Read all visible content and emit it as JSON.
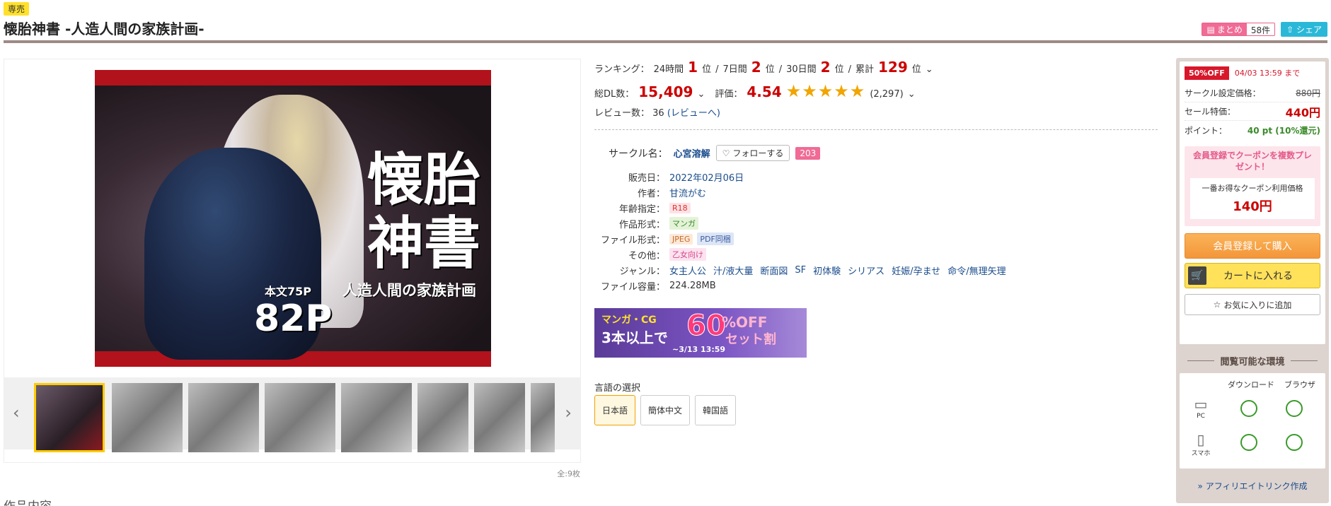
{
  "header": {
    "exclusive_badge": "専売",
    "title": "懐胎神書 -人造人間の家族計画-",
    "matome_label": "まとめ",
    "matome_count": "58件",
    "share_label": "シェア"
  },
  "gallery": {
    "cover_title_line1": "懐胎",
    "cover_title_line2": "神書",
    "cover_subtitle": "人造人間の家族計画",
    "cover_pages_small": "本文75P",
    "cover_pages": "82P",
    "total_images": "全:9枚"
  },
  "ranking": {
    "label": "ランキング：",
    "day_label": "24時間",
    "day_rank": "1",
    "week_label": "7日間",
    "week_rank": "2",
    "month_label": "30日間",
    "month_rank": "2",
    "total_label": "累計",
    "total_rank": "129",
    "unit": "位",
    "sep": "/"
  },
  "stats": {
    "dl_label": "総DL数：",
    "dl_count": "15,409",
    "rating_label": "評価：",
    "rating": "4.54",
    "stars": "★★★★★",
    "rating_count": "(2,297)",
    "review_label": "レビュー数：",
    "review_count": "36",
    "review_link": "(レビューへ)"
  },
  "circle": {
    "label": "サークル名：",
    "name": "心宮溶解",
    "follow_label": "フォローする",
    "follow_count": "203"
  },
  "specs": {
    "release_label": "販売日：",
    "release_date": "2022年02月06日",
    "author_label": "作者：",
    "author": "甘流がむ",
    "age_label": "年齢指定：",
    "age": "R18",
    "format_label": "作品形式：",
    "format": "マンガ",
    "file_label": "ファイル形式：",
    "file_type1": "JPEG",
    "file_type2": "PDF同梱",
    "other_label": "その他：",
    "other": "乙女向け",
    "genre_label": "ジャンル：",
    "genres": [
      "女主人公",
      "汁/液大量",
      "断面図",
      "SF",
      "初体験",
      "シリアス",
      "妊娠/孕ませ",
      "命令/無理矢理"
    ],
    "size_label": "ファイル容量：",
    "size": "224.28MB"
  },
  "banner": {
    "line1": "マンガ・CG",
    "line2": "3本以上で",
    "percent": "60",
    "off": "%OFF",
    "set": "セット割",
    "date": "~3/13 13:59"
  },
  "language": {
    "label": "言語の選択",
    "options": [
      "日本語",
      "簡体中文",
      "韓国語"
    ]
  },
  "sidebar": {
    "sale_badge": "50%OFF",
    "sale_until": "04/03 13:59 まで",
    "circle_price_label": "サークル設定価格：",
    "circle_price": "880円",
    "sale_price_label": "セール特価：",
    "sale_price": "440円",
    "point_label": "ポイント：",
    "point_value": "40 pt (10%還元)",
    "coupon_head": "会員登録でクーポンを複数プレゼント！",
    "coupon_price_label": "一番お得なクーポン利用価格",
    "coupon_price": "140円",
    "buy_label": "会員登録して購入",
    "cart_label": "カートに入れる",
    "fav_label": "お気に入りに追加",
    "env_title": "閲覧可能な環境",
    "env_download": "ダウンロード",
    "env_browser": "ブラウザ",
    "env_pc": "PC",
    "env_phone": "スマホ",
    "affiliate": "» アフィリエイトリンク作成"
  },
  "content_label": "作品内容",
  "colors": {
    "accent_red": "#cc0000",
    "link_blue": "#1a4c8c",
    "pink": "#f06b95",
    "sale_red": "#d8172a"
  }
}
